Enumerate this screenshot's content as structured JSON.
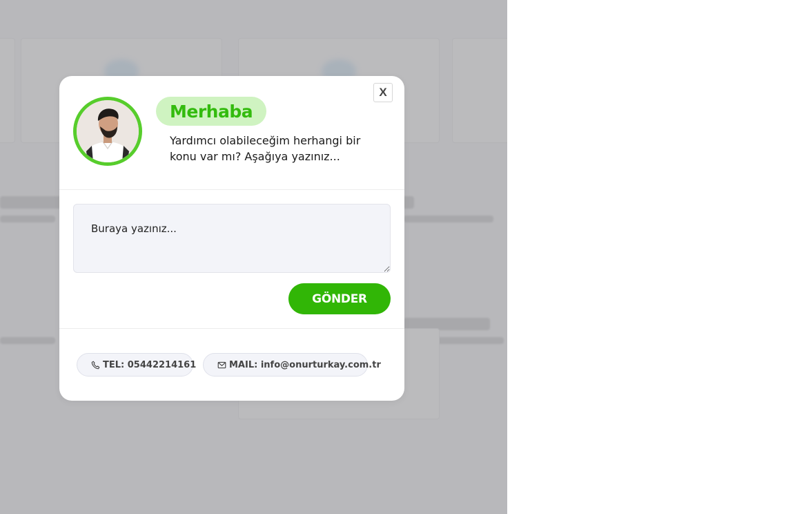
{
  "modal": {
    "close_label": "X",
    "greeting": "Merhaba",
    "intro_text": "Yardımcı olabileceğim herhangi bir konu var mı? Aşağıya yazınız...",
    "message_placeholder": "Buraya yazınız...",
    "message_value": "",
    "send_label": "GÖNDER",
    "contacts": {
      "phone": {
        "label": "TEL: 05442214161",
        "icon": "phone-icon"
      },
      "email": {
        "label": "MAIL: info@onurturkay.com.tr",
        "icon": "envelope-icon"
      }
    }
  },
  "colors": {
    "accent_green": "#31b606",
    "greeting_text": "#33bb0e",
    "greeting_bg": "#cff3c1",
    "avatar_ring": "#57cd2c"
  }
}
